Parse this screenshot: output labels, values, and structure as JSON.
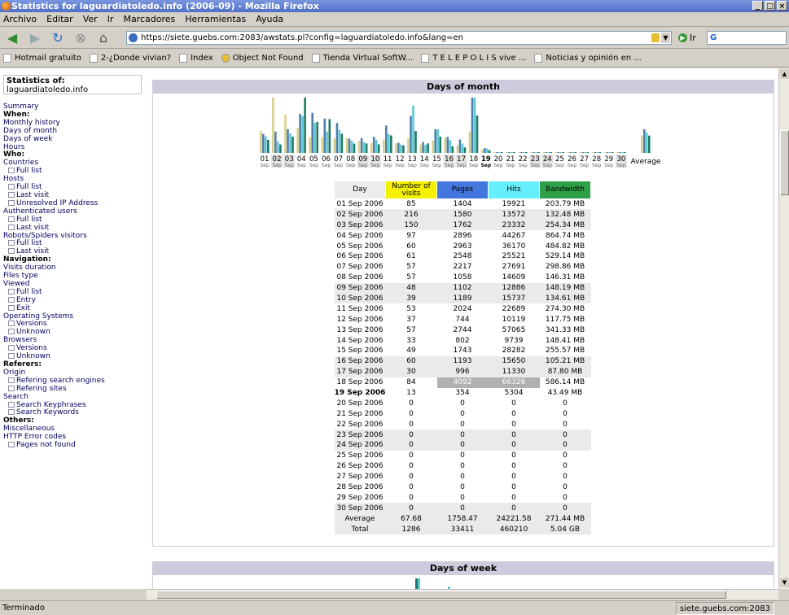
{
  "window": {
    "title": "Statistics for laguardiatoledo.info (2006-09) - Mozilla Firefox"
  },
  "menu": [
    "Archivo",
    "Editar",
    "Ver",
    "Ir",
    "Marcadores",
    "Herramientas",
    "Ayuda"
  ],
  "nav": {
    "url": "https://siete.guebs.com:2083/awstats.pl?config=laguardiatoledo.info&lang=en",
    "go_label": "Ir",
    "search_value": "G"
  },
  "bookmarks": [
    "Hotmail gratuito",
    "2-¿Donde vivian?",
    "Index",
    "Object Not Found",
    "Tienda Virtual SoftW...",
    "T E L E P O L I S vive ...",
    "Noticias y opinión en ..."
  ],
  "status": {
    "text": "Terminado",
    "host": "siete.guebs.com:2083"
  },
  "sidebar": {
    "stats_of_label": "Statistics of:",
    "site": "laguardiatoledo.info",
    "items": [
      {
        "t": "Summary",
        "k": "m"
      },
      {
        "t": "When:",
        "k": "h"
      },
      {
        "t": "Monthly history",
        "k": "m"
      },
      {
        "t": "Days of month",
        "k": "m"
      },
      {
        "t": "Days of week",
        "k": "m"
      },
      {
        "t": "Hours",
        "k": "m"
      },
      {
        "t": "Who:",
        "k": "h"
      },
      {
        "t": "Countries",
        "k": "m"
      },
      {
        "t": "Full list",
        "k": "s"
      },
      {
        "t": "Hosts",
        "k": "m"
      },
      {
        "t": "Full list",
        "k": "s"
      },
      {
        "t": "Last visit",
        "k": "s"
      },
      {
        "t": "Unresolved IP Address",
        "k": "s"
      },
      {
        "t": "Authenticated users",
        "k": "m"
      },
      {
        "t": "Full list",
        "k": "s"
      },
      {
        "t": "Last visit",
        "k": "s"
      },
      {
        "t": "Robots/Spiders visitors",
        "k": "m"
      },
      {
        "t": "Full list",
        "k": "s"
      },
      {
        "t": "Last visit",
        "k": "s"
      },
      {
        "t": "Navigation:",
        "k": "h"
      },
      {
        "t": "Visits duration",
        "k": "m"
      },
      {
        "t": "Files type",
        "k": "m"
      },
      {
        "t": "Viewed",
        "k": "m"
      },
      {
        "t": "Full list",
        "k": "s"
      },
      {
        "t": "Entry",
        "k": "s"
      },
      {
        "t": "Exit",
        "k": "s"
      },
      {
        "t": "Operating Systems",
        "k": "m"
      },
      {
        "t": "Versions",
        "k": "s"
      },
      {
        "t": "Unknown",
        "k": "s"
      },
      {
        "t": "Browsers",
        "k": "m"
      },
      {
        "t": "Versions",
        "k": "s"
      },
      {
        "t": "Unknown",
        "k": "s"
      },
      {
        "t": "Referers:",
        "k": "h"
      },
      {
        "t": "Origin",
        "k": "m"
      },
      {
        "t": "Refering search engines",
        "k": "s"
      },
      {
        "t": "Refering sites",
        "k": "s"
      },
      {
        "t": "Search",
        "k": "m"
      },
      {
        "t": "Search Keyphrases",
        "k": "s"
      },
      {
        "t": "Search Keywords",
        "k": "s"
      },
      {
        "t": "Others:",
        "k": "h"
      },
      {
        "t": "Miscellaneous",
        "k": "m"
      },
      {
        "t": "HTTP Error codes",
        "k": "m"
      },
      {
        "t": "Pages not found",
        "k": "s"
      }
    ]
  },
  "panel": {
    "title": "Days of month",
    "title2": "Days of week"
  },
  "colors": {
    "visits": "#f4f000",
    "pages": "#4477dd",
    "hits": "#66f0ff",
    "bandwidth": "#2ea047"
  },
  "table": {
    "headers": [
      "Day",
      "Number of visits",
      "Pages",
      "Hits",
      "Bandwidth"
    ],
    "rows": [
      [
        "01 Sep 2006",
        "85",
        "1404",
        "19921",
        "203.79 MB"
      ],
      [
        "02 Sep 2006",
        "216",
        "1580",
        "13572",
        "132.48 MB"
      ],
      [
        "03 Sep 2006",
        "150",
        "1762",
        "23332",
        "254.34 MB"
      ],
      [
        "04 Sep 2006",
        "97",
        "2896",
        "44267",
        "864.74 MB"
      ],
      [
        "05 Sep 2006",
        "60",
        "2963",
        "36170",
        "484.82 MB"
      ],
      [
        "06 Sep 2006",
        "61",
        "2548",
        "25521",
        "529.14 MB"
      ],
      [
        "07 Sep 2006",
        "57",
        "2217",
        "27691",
        "298.86 MB"
      ],
      [
        "08 Sep 2006",
        "57",
        "1058",
        "14609",
        "146.31 MB"
      ],
      [
        "09 Sep 2006",
        "48",
        "1102",
        "12886",
        "148.19 MB"
      ],
      [
        "10 Sep 2006",
        "39",
        "1189",
        "15737",
        "134.61 MB"
      ],
      [
        "11 Sep 2006",
        "53",
        "2024",
        "22689",
        "274.30 MB"
      ],
      [
        "12 Sep 2006",
        "37",
        "744",
        "10119",
        "117.75 MB"
      ],
      [
        "13 Sep 2006",
        "57",
        "2744",
        "57065",
        "341.33 MB"
      ],
      [
        "14 Sep 2006",
        "33",
        "802",
        "9739",
        "148.41 MB"
      ],
      [
        "15 Sep 2006",
        "49",
        "1743",
        "28282",
        "255.57 MB"
      ],
      [
        "16 Sep 2006",
        "60",
        "1193",
        "15650",
        "105.21 MB"
      ],
      [
        "17 Sep 2006",
        "30",
        "996",
        "11330",
        "87.80 MB"
      ],
      [
        "18 Sep 2006",
        "84",
        "4092",
        "66326",
        "586.14 MB"
      ],
      [
        "19 Sep 2006",
        "13",
        "354",
        "5304",
        "43.49 MB"
      ],
      [
        "20 Sep 2006",
        "0",
        "0",
        "0",
        "0"
      ],
      [
        "21 Sep 2006",
        "0",
        "0",
        "0",
        "0"
      ],
      [
        "22 Sep 2006",
        "0",
        "0",
        "0",
        "0"
      ],
      [
        "23 Sep 2006",
        "0",
        "0",
        "0",
        "0"
      ],
      [
        "24 Sep 2006",
        "0",
        "0",
        "0",
        "0"
      ],
      [
        "25 Sep 2006",
        "0",
        "0",
        "0",
        "0"
      ],
      [
        "26 Sep 2006",
        "0",
        "0",
        "0",
        "0"
      ],
      [
        "27 Sep 2006",
        "0",
        "0",
        "0",
        "0"
      ],
      [
        "28 Sep 2006",
        "0",
        "0",
        "0",
        "0"
      ],
      [
        "29 Sep 2006",
        "0",
        "0",
        "0",
        "0"
      ],
      [
        "30 Sep 2006",
        "0",
        "0",
        "0",
        "0"
      ]
    ],
    "weekend_rows": [
      1,
      2,
      8,
      9,
      15,
      16,
      22,
      23,
      29
    ],
    "today_row": 18,
    "average": [
      "Average",
      "67.68",
      "1758.47",
      "24221.58",
      "271.44 MB"
    ],
    "total": [
      "Total",
      "1286",
      "33411",
      "460210",
      "5.04 GB"
    ]
  },
  "chart_data": {
    "type": "bar",
    "title": "Days of month",
    "categories": [
      "01",
      "02",
      "03",
      "04",
      "05",
      "06",
      "07",
      "08",
      "09",
      "10",
      "11",
      "12",
      "13",
      "14",
      "15",
      "16",
      "17",
      "18",
      "19",
      "20",
      "21",
      "22",
      "23",
      "24",
      "25",
      "26",
      "27",
      "28",
      "29",
      "30"
    ],
    "sublabel": "Sep",
    "average_label": "Average",
    "series": [
      {
        "name": "Number of visits",
        "color": "#d8d08a",
        "values": [
          85,
          216,
          150,
          97,
          60,
          61,
          57,
          57,
          48,
          39,
          53,
          37,
          57,
          33,
          49,
          60,
          30,
          84,
          13,
          0,
          0,
          0,
          0,
          0,
          0,
          0,
          0,
          0,
          0,
          0
        ],
        "average": 67.68
      },
      {
        "name": "Pages",
        "color": "#4f7fa8",
        "values": [
          1404,
          1580,
          1762,
          2896,
          2963,
          2548,
          2217,
          1058,
          1102,
          1189,
          2024,
          744,
          2744,
          802,
          1743,
          1193,
          996,
          4092,
          354,
          0,
          0,
          0,
          0,
          0,
          0,
          0,
          0,
          0,
          0,
          0
        ],
        "average": 1758.47
      },
      {
        "name": "Hits",
        "color": "#5cc8d8",
        "values": [
          19921,
          13572,
          23332,
          44267,
          36170,
          25521,
          27691,
          14609,
          12886,
          15737,
          22689,
          10119,
          57065,
          9739,
          28282,
          15650,
          11330,
          66326,
          5304,
          0,
          0,
          0,
          0,
          0,
          0,
          0,
          0,
          0,
          0,
          0
        ],
        "average": 24221.58
      },
      {
        "name": "Bandwidth",
        "color": "#1e7a60",
        "values": [
          203.79,
          132.48,
          254.34,
          864.74,
          484.82,
          529.14,
          298.86,
          146.31,
          148.19,
          134.61,
          274.3,
          117.75,
          341.33,
          148.41,
          255.57,
          105.21,
          87.8,
          586.14,
          43.49,
          0,
          0,
          0,
          0,
          0,
          0,
          0,
          0,
          0,
          0,
          0
        ],
        "average": 271.44
      }
    ],
    "weekend_days": [
      "02",
      "03",
      "09",
      "10",
      "16",
      "17",
      "23",
      "24",
      "30"
    ],
    "today": "19"
  }
}
